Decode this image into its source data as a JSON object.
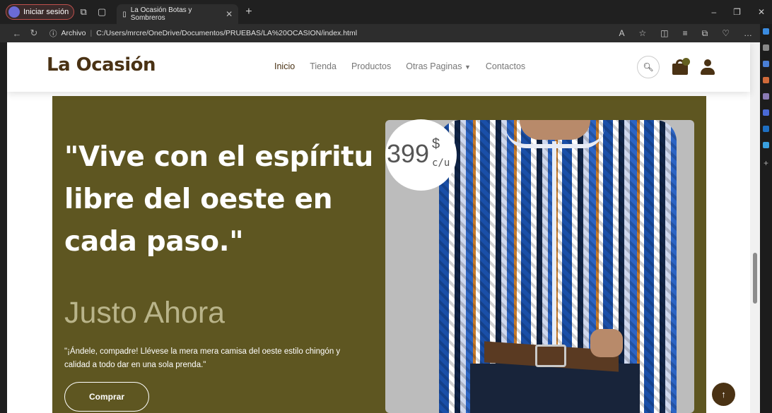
{
  "browser": {
    "profile_label": "Iniciar sesión",
    "tab_title": "La Ocasión Botas y Sombreros",
    "address_prefix": "Archivo",
    "address_url": "C:/Users/mrcre/OneDrive/Documentos/PRUEBAS/LA%20OCASION/index.html"
  },
  "site": {
    "logo": "La Ocasión",
    "menu": [
      "Inicio",
      "Tienda",
      "Productos",
      "Otras Paginas",
      "Contactos"
    ]
  },
  "hero": {
    "headline": "\"Vive con el espíritu libre del oeste en cada paso.\"",
    "subhead": "Justo Ahora",
    "description": "\"¡Ándele, compadre! Llévese la mera mera camisa del oeste estilo chingón y calidad a todo dar en una sola prenda.\"",
    "button": "Comprar",
    "price_value": "399",
    "price_currency": "$",
    "price_unit": "c/u"
  },
  "colors": {
    "brand_brown": "#4a3214",
    "hero_olive": "#5e5621"
  }
}
